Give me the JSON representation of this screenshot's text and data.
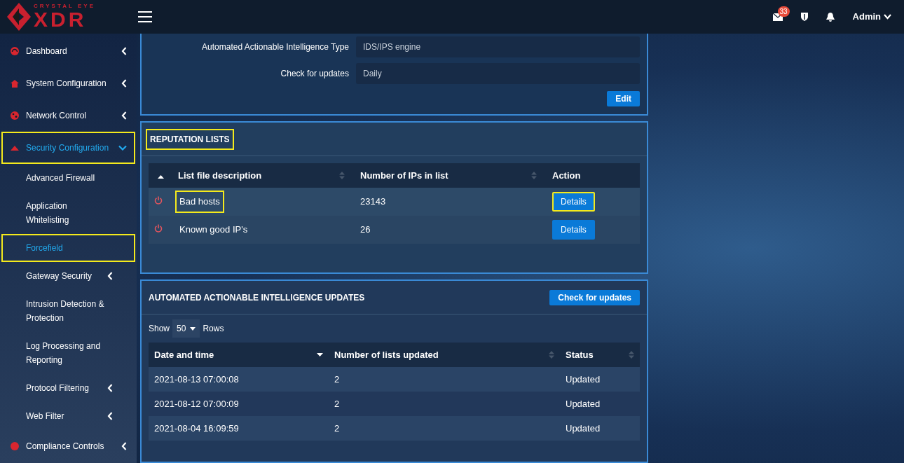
{
  "header": {
    "logo_top": "CRYSTAL EYE",
    "logo_main": "XDR",
    "mail_count": "33",
    "user": "Admin"
  },
  "sidebar": {
    "items": [
      {
        "label": "Dashboard",
        "expanded": false,
        "selected": false,
        "highlighted": false
      },
      {
        "label": "System Configuration",
        "expanded": false,
        "selected": false,
        "highlighted": false
      },
      {
        "label": "Network Control",
        "expanded": false,
        "selected": false,
        "highlighted": false
      },
      {
        "label": "Security Configuration",
        "expanded": true,
        "selected": true,
        "highlighted": true,
        "children": [
          {
            "label": "Advanced Firewall",
            "selected": false,
            "highlighted": false,
            "has_submenu": false
          },
          {
            "label": "Application Whitelisting",
            "selected": false,
            "highlighted": false,
            "has_submenu": false
          },
          {
            "label": "Forcefield",
            "selected": true,
            "highlighted": true,
            "has_submenu": false
          },
          {
            "label": "Gateway Security",
            "selected": false,
            "highlighted": false,
            "has_submenu": true
          },
          {
            "label": "Intrusion Detection & Protection",
            "selected": false,
            "highlighted": false,
            "has_submenu": false
          },
          {
            "label": "Log Processing and Reporting",
            "selected": false,
            "highlighted": false,
            "has_submenu": false
          },
          {
            "label": "Protocol Filtering",
            "selected": false,
            "highlighted": false,
            "has_submenu": true
          },
          {
            "label": "Web Filter",
            "selected": false,
            "highlighted": false,
            "has_submenu": true
          }
        ]
      },
      {
        "label": "Compliance Controls",
        "expanded": false,
        "selected": false,
        "highlighted": false
      }
    ]
  },
  "properties": {
    "fields": [
      {
        "label": "Automated Actionable Intelligence Type",
        "value": "IDS/IPS engine"
      },
      {
        "label": "Check for updates",
        "value": "Daily"
      }
    ],
    "button": "Edit"
  },
  "reputation_lists": {
    "title": "REPUTATION LISTS",
    "title_highlighted": true,
    "columns": [
      "List file description",
      "Number of IPs in list",
      "Action"
    ],
    "rows": [
      {
        "enabled": false,
        "description": "Bad hosts",
        "count": "23143",
        "action": "Details",
        "highlighted": true
      },
      {
        "enabled": false,
        "description": "Known good IP's",
        "count": "26",
        "action": "Details",
        "highlighted": false
      }
    ]
  },
  "updates": {
    "title": "AUTOMATED ACTIONABLE INTELLIGENCE UPDATES",
    "button": "Check for updates",
    "show_label": "Show",
    "page_size": "50",
    "rows_label": "Rows",
    "columns": [
      "Date and time",
      "Number of lists updated",
      "Status"
    ],
    "rows": [
      {
        "date": "2021-08-13 07:00:08",
        "lists": "2",
        "status": "Updated"
      },
      {
        "date": "2021-08-12 07:00:09",
        "lists": "2",
        "status": "Updated"
      },
      {
        "date": "2021-08-04 16:09:59",
        "lists": "2",
        "status": "Updated"
      }
    ]
  }
}
